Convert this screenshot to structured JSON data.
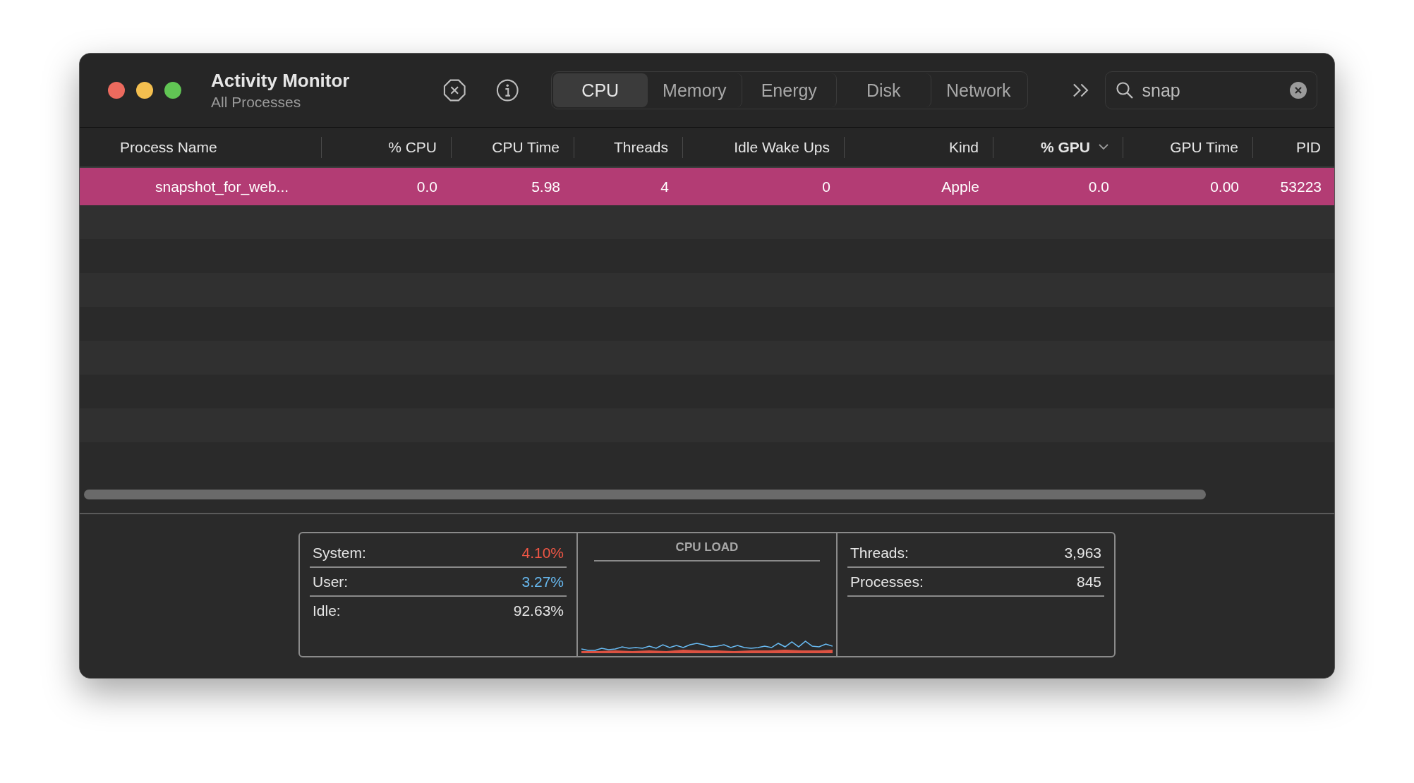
{
  "window": {
    "title": "Activity Monitor",
    "subtitle": "All Processes"
  },
  "tabs": [
    {
      "label": "CPU",
      "selected": true
    },
    {
      "label": "Memory",
      "selected": false
    },
    {
      "label": "Energy",
      "selected": false
    },
    {
      "label": "Disk",
      "selected": false
    },
    {
      "label": "Network",
      "selected": false
    }
  ],
  "search": {
    "value": "snap"
  },
  "table": {
    "columns": [
      {
        "label": "Process Name",
        "sorted": false
      },
      {
        "label": "% CPU",
        "sorted": false
      },
      {
        "label": "CPU Time",
        "sorted": false
      },
      {
        "label": "Threads",
        "sorted": false
      },
      {
        "label": "Idle Wake Ups",
        "sorted": false
      },
      {
        "label": "Kind",
        "sorted": false
      },
      {
        "label": "% GPU",
        "sorted": true
      },
      {
        "label": "GPU Time",
        "sorted": false
      },
      {
        "label": "PID",
        "sorted": false
      }
    ],
    "rows": [
      {
        "selected": true,
        "cells": [
          "snapshot_for_web...",
          "0.0",
          "5.98",
          "4",
          "0",
          "Apple",
          "0.0",
          "0.00",
          "53223"
        ]
      }
    ]
  },
  "cpu_stats": [
    {
      "label": "System:",
      "value": "4.10%",
      "color": "#ef5645"
    },
    {
      "label": "User:",
      "value": "3.27%",
      "color": "#67b8ef"
    },
    {
      "label": "Idle:",
      "value": "92.63%",
      "color": "#e6e6e6"
    }
  ],
  "cpu_load": {
    "title": "CPU LOAD"
  },
  "counts": [
    {
      "label": "Threads:",
      "value": "3,963"
    },
    {
      "label": "Processes:",
      "value": "845"
    }
  ]
}
